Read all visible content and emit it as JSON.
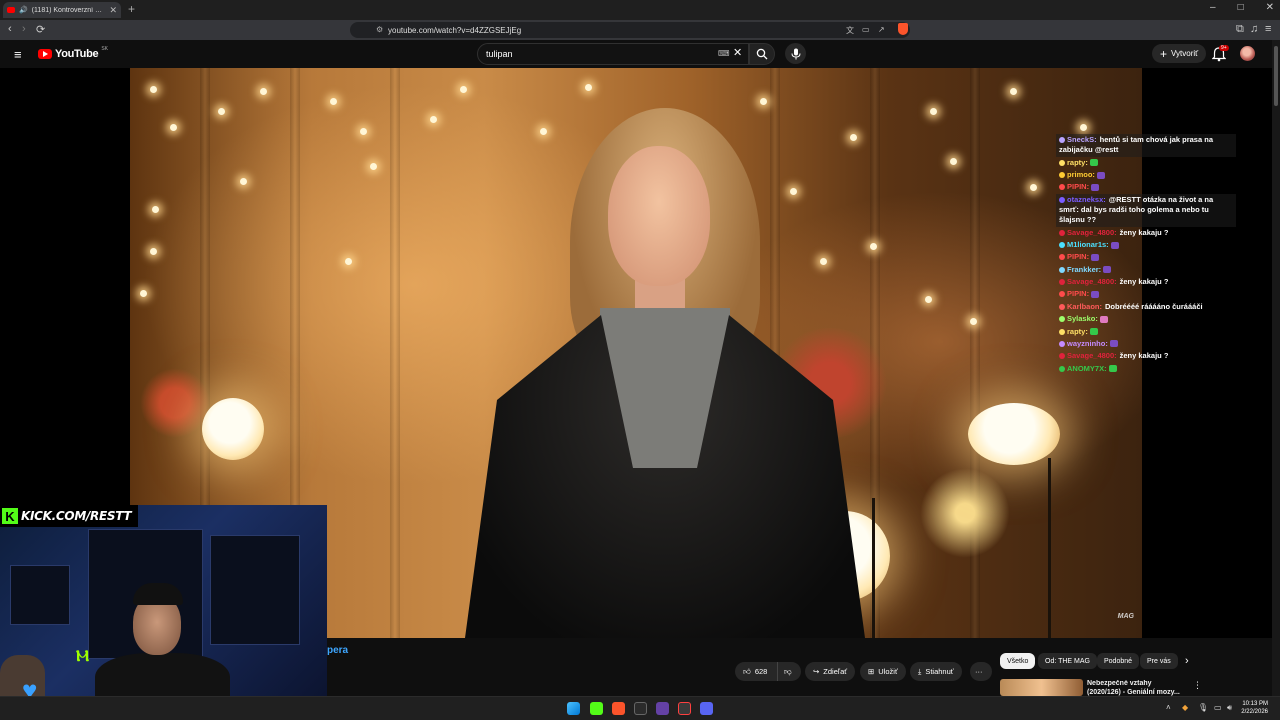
{
  "browser": {
    "tab_title": "(1181) Kontroverzní výzva • Y",
    "url": "youtube.com/watch?v=d4ZZGSEJjEg",
    "new_tab": "+",
    "win_minimize": "–",
    "win_maximize": "□",
    "win_close": "✕"
  },
  "youtube": {
    "logo_text": "YouTube",
    "logo_region": "SK",
    "search_value": "tulipan",
    "create_label": "Vytvoriť",
    "notif_count": "9+"
  },
  "chat": [
    {
      "user": "SneckS:",
      "text": "hentů si tam chová jak prasa na zabijačku @restt",
      "user_color": "#b9a4ff",
      "highlight": true
    },
    {
      "user": "rapty:",
      "text": "",
      "user_color": "#ffe066",
      "emote": "#35c84a"
    },
    {
      "user": "primoo:",
      "text": "",
      "user_color": "#ffcc33",
      "emote": "#7a4cc2"
    },
    {
      "user": "PIPIN:",
      "text": "",
      "user_color": "#ff4b4b",
      "emote": "#7a4cc2"
    },
    {
      "user": "otazneksx:",
      "text": "@RESTT otázka na život a na smrť: dal bys radši toho golema a nebo tu šlajsnu ??",
      "user_color": "#7a5cff",
      "highlight": true
    },
    {
      "user": "Savage_4800:",
      "text": "ženy kakaju ?",
      "user_color": "#e0223c"
    },
    {
      "user": "M1lionar1s:",
      "text": "",
      "user_color": "#4be0ff",
      "emote": "#7a4cc2"
    },
    {
      "user": "PIPIN:",
      "text": "",
      "user_color": "#ff4b4b",
      "emote": "#7a4cc2"
    },
    {
      "user": "Frankker:",
      "text": "",
      "user_color": "#7fd8ff",
      "emote": "#7a4cc2"
    },
    {
      "user": "Savage_4800:",
      "text": "ženy kakaju ?",
      "user_color": "#e0223c"
    },
    {
      "user": "PIPIN:",
      "text": "",
      "user_color": "#ff4b4b",
      "emote": "#7a4cc2"
    },
    {
      "user": "Karlbaon:",
      "text": "Dobréééé rááááno čuráááči",
      "user_color": "#ff5a5a"
    },
    {
      "user": "Sylasko:",
      "text": "",
      "user_color": "#9cff6b",
      "emote": "#e07ac0"
    },
    {
      "user": "rapty:",
      "text": "",
      "user_color": "#ffe066",
      "emote": "#35c84a"
    },
    {
      "user": "wayzninho:",
      "text": "",
      "user_color": "#c48bff",
      "emote": "#7a4cc2"
    },
    {
      "user": "Savage_4800:",
      "text": "ženy kakaju ?",
      "user_color": "#e0223c"
    },
    {
      "user": "ANOMY7X:",
      "text": "",
      "user_color": "#35c84a",
      "emote": "#35c84a"
    }
  ],
  "cam": {
    "kick_logo": "K",
    "kick_text": "KICK.COM/RESTT"
  },
  "video": {
    "watermark": "MAG",
    "title_fragment": "pera"
  },
  "actions": {
    "likes": "628",
    "share": "Zdieľať",
    "save": "Uložiť",
    "download": "Stiahnuť",
    "more": "···"
  },
  "chips": [
    "Všetko",
    "Od: THE MAG",
    "Podobné",
    "Pre vás"
  ],
  "recommendation": {
    "title": "Nebezpečné vztahy (2020/126) - Geniální mozy..."
  },
  "taskbar": {
    "time": "10:13 PM",
    "date": "2/22/2026"
  },
  "colors": {
    "youtube_red": "#ff0000",
    "kick_green": "#53fc18",
    "link_blue": "#3ea6ff",
    "page_bg": "#0f0f0f"
  }
}
